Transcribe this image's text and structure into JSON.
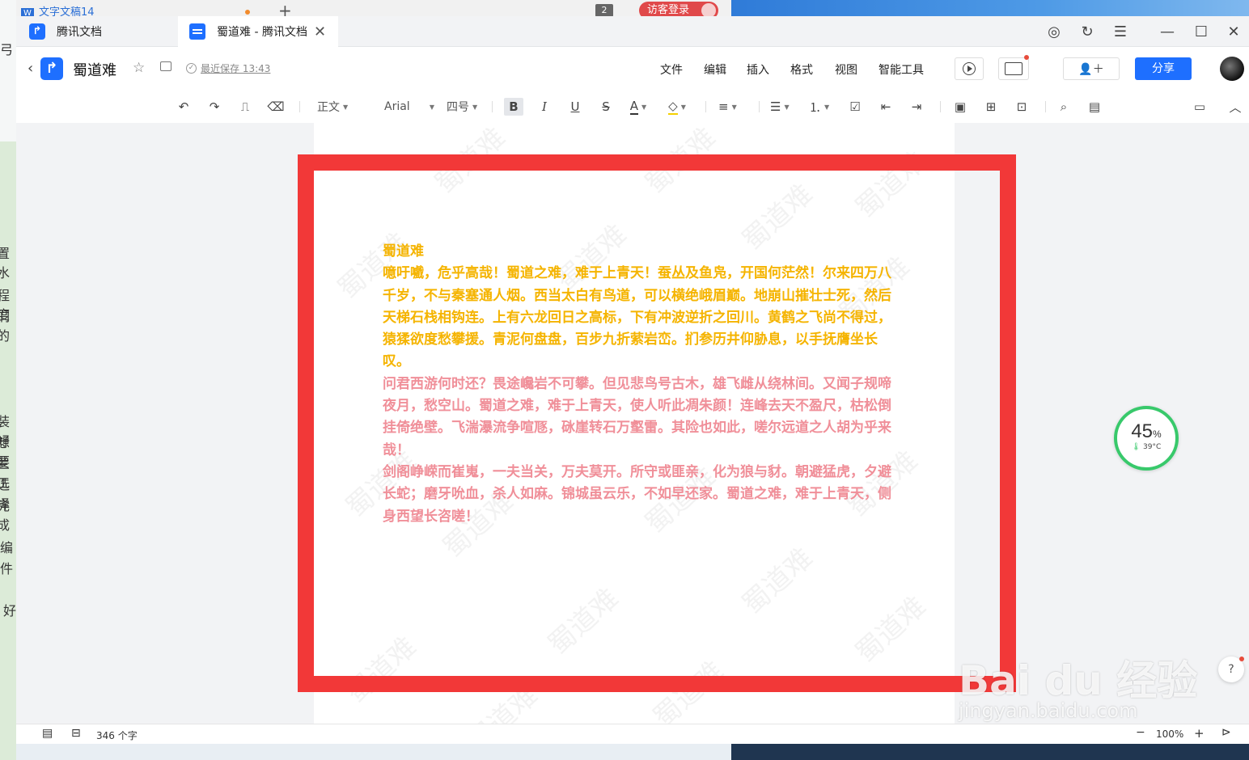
{
  "background": {
    "tab_title": "文字文稿14",
    "tab_badge": "2",
    "visitor_login": "访客登录",
    "left_edge_text": [
      "弓",
      "置水",
      "程度",
      "们的",
      "装好",
      "想要",
      "兰工",
      "选择",
      "完成",
      "编",
      "件",
      "好"
    ]
  },
  "tabs": [
    {
      "label": "腾讯文档"
    },
    {
      "label": "蜀道难 - 腾讯文档"
    }
  ],
  "header": {
    "title": "蜀道难",
    "saved_status": "最近保存 13:43",
    "menu": [
      "文件",
      "编辑",
      "插入",
      "格式",
      "视图",
      "智能工具"
    ],
    "share_label": "分享"
  },
  "toolbar": {
    "style": "正文",
    "font": "Arial",
    "size": "四号"
  },
  "document": {
    "watermark": "蜀道难",
    "yellow_paragraphs": [
      "蜀道难",
      "噫吁嚱，危乎高哉！蜀道之难，难于上青天！蚕丛及鱼凫，开国何茫然！尔来四万八千岁，不与秦塞通人烟。西当太白有鸟道，可以横绝峨眉巅。地崩山摧壮士死，然后天梯石栈相钩连。上有六龙回日之高标，下有冲波逆折之回川。黄鹤之飞尚不得过，猿猱欲度愁攀援。青泥何盘盘，百步九折萦岩峦。扪参历井仰胁息，以手抚膺坐长叹。"
    ],
    "pink_paragraphs": [
      "问君西游何时还？畏途巉岩不可攀。但见悲鸟号古木，雄飞雌从绕林间。又闻子规啼夜月，愁空山。蜀道之难，难于上青天，使人听此凋朱颜！连峰去天不盈尺，枯松倒挂倚绝壁。飞湍瀑流争喧豗，砯崖转石万壑雷。其险也如此，嗟尔远道之人胡为乎来哉！",
      "剑阁峥嵘而崔嵬，一夫当关，万夫莫开。所守或匪亲，化为狼与豺。朝避猛虎，夕避长蛇；磨牙吮血，杀人如麻。锦城虽云乐，不如早还家。蜀道之难，难于上青天，侧身西望长咨嗟！"
    ]
  },
  "widget": {
    "percent": "45",
    "percent_unit": "%",
    "temperature": "39°C"
  },
  "help_label": "?",
  "watermark_baidu": {
    "brand": "Bai du 经验",
    "url": "jingyan.baidu.com"
  },
  "statusbar": {
    "word_count": "346 个字",
    "zoom": "100%"
  },
  "colors": {
    "accent": "#1e6fff",
    "highlight_box": "#f23838",
    "yellow_text": "#f5b400",
    "pink_text": "#f08f99",
    "gauge_ring": "#38c96b"
  }
}
